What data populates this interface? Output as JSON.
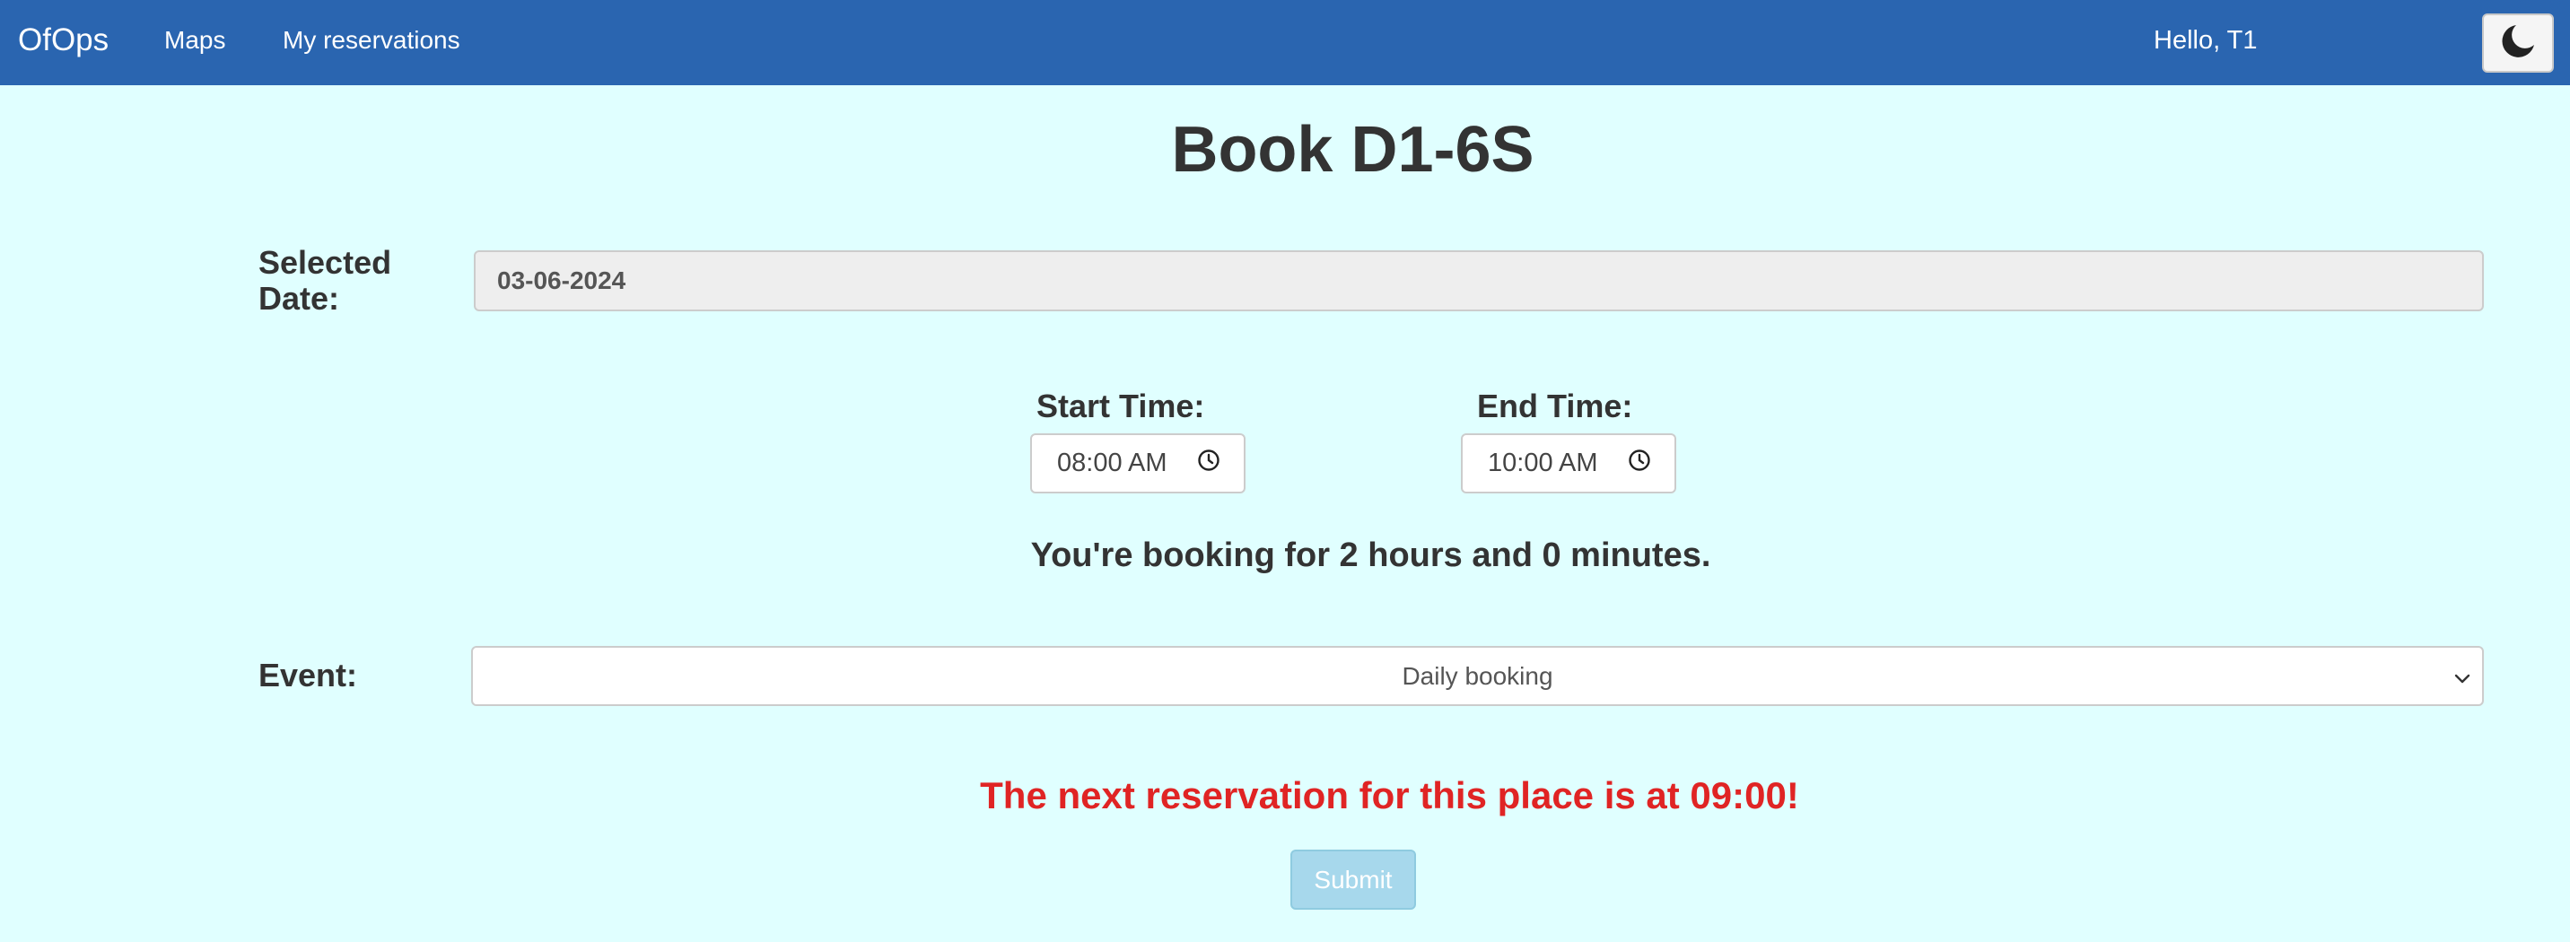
{
  "navbar": {
    "brand": "OfOps",
    "links": [
      "Maps",
      "My reservations"
    ],
    "greeting": "Hello, T1",
    "theme_toggle_icon": "moon-icon",
    "background_color": "#2a65b0"
  },
  "page": {
    "title": "Book D1-6S",
    "background_color": "#e0ffff"
  },
  "form": {
    "date_label": "Selected Date:",
    "date_value": "03-06-2024",
    "start_label": "Start Time:",
    "start_value": "08:00 AM",
    "end_label": "End Time:",
    "end_value": "10:00 AM",
    "time_icon": "clock-icon",
    "duration_text": "You're booking for 2 hours and 0 minutes.",
    "event_label": "Event:",
    "event_selected": "Daily booking",
    "warning_text": "The next reservation for this place is at 09:00!",
    "warning_color": "#e02424",
    "submit_label": "Submit",
    "submit_state": "disabled"
  }
}
